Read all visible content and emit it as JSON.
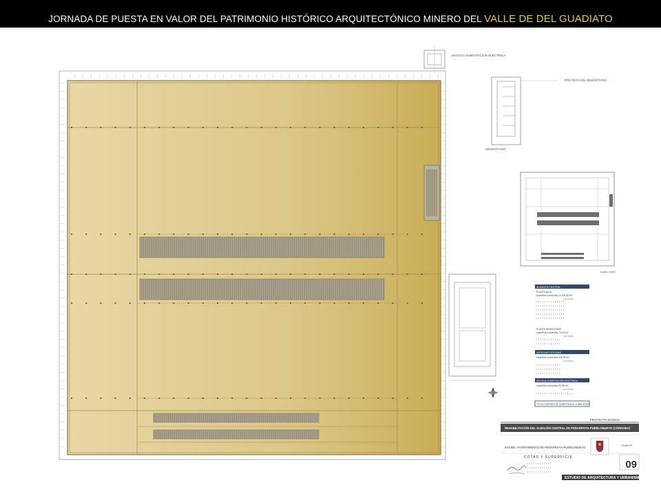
{
  "header": {
    "title_main": "JORNADA DE PUESTA EN VALOR DEL PATRIMONIO HISTÓRICO ARQUITECTÓNICO MINERO DEL",
    "title_highlight": "VALLE DE DEL GUADIATO"
  },
  "plan_labels": {
    "substation": "ANTIGUA SUBESTACIÓN ELÉCTRICA",
    "projection": "PROYECCIÓN SEMISÓTANO",
    "basement": "SEMISÓTANO",
    "key_scale": "escala 1/1000"
  },
  "surface_table": {
    "sections": [
      {
        "heading": "ALMACÉN CENTRAL",
        "lines": [
          "PLANTA BAJA",
          "superficie construida 14.208,65 m2"
        ],
        "tag": "m2 ÚTILES"
      },
      {
        "heading": "",
        "lines": [
          "PLANTA SEMISÓTANO",
          "superficie construida 73,15 m2"
        ],
        "tag": "m2 ÚTILES"
      },
      {
        "heading": "ANTIGUAS OFICINAS",
        "lines": [
          "superficie construida 348,95 m2"
        ],
        "tag": "m2 ÚTILES"
      },
      {
        "heading": "ANTIGUA SUBESTACIÓN ELÉCTRICA",
        "lines": [
          "superficie construida 25,55 m2"
        ],
        "tag": "m2 ÚTILES"
      }
    ],
    "total": "TOTAL SUPERFICIE CONSTRUIDA 14.855,30 M2"
  },
  "title_block": {
    "project_type": "PROYECTO BÁSICO",
    "project_title": "REHABILITACIÓN DEL ALMACÉN CENTRAL DE PEÑARROYA-PUEBLONUEVO (CÓRDOBA)",
    "client": "EXCMO. AYUNTAMIENTO DE PEÑARROYA-PUEBLONUEVO",
    "sheet_title": "COTAS Y SUPERFICIE",
    "sheet_label": "PLANO Nº",
    "sheet_number": "09",
    "studio": "ESTUDIO DE ARQUITECTURA Y URBANISMO"
  },
  "colors": {
    "hall_fill_light": "#e8d7a6",
    "hall_fill_dark": "#c9ad56",
    "strip_fill": "#a59d8a",
    "title_highlight": "#e2c948"
  }
}
